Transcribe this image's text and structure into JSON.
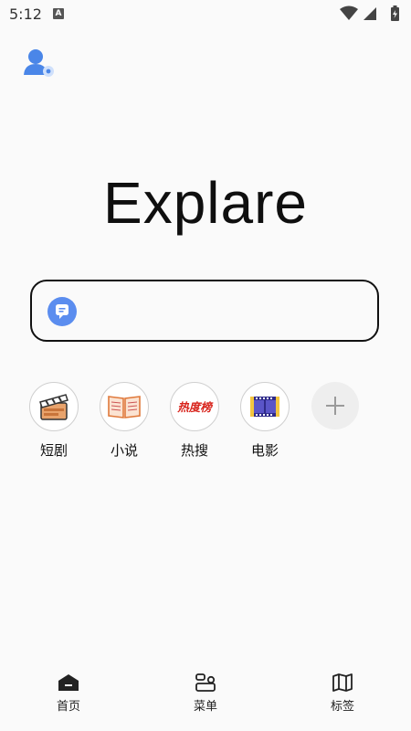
{
  "status_bar": {
    "time": "5:12",
    "notification_glyph": "A",
    "icons": [
      "wifi-icon",
      "signal-icon",
      "battery-charging-icon"
    ]
  },
  "header": {
    "profile_icon": "user-profile-icon",
    "brand_title": "Explare"
  },
  "search": {
    "value": "",
    "placeholder": "",
    "icon": "chat-bubble-icon",
    "accent_color": "#5b8def"
  },
  "shortcuts": [
    {
      "label": "短剧",
      "icon": "clapperboard-icon"
    },
    {
      "label": "小说",
      "icon": "open-book-icon"
    },
    {
      "label": "热搜",
      "icon": "hot-list-icon",
      "icon_text": "热度榜"
    },
    {
      "label": "电影",
      "icon": "film-strip-icon"
    }
  ],
  "add_shortcut": {
    "icon": "plus-icon"
  },
  "tab_bar": {
    "tabs": [
      {
        "label": "首页",
        "icon": "home-icon",
        "active": true
      },
      {
        "label": "菜单",
        "icon": "menu-icon",
        "active": false
      },
      {
        "label": "标签",
        "icon": "map-icon",
        "active": false
      }
    ]
  }
}
